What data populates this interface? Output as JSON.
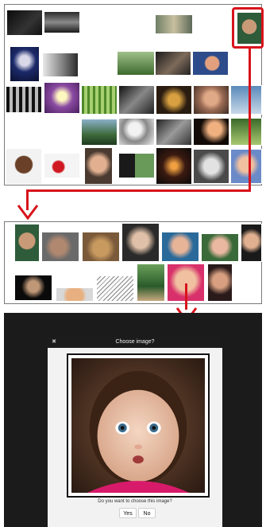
{
  "dialog": {
    "title": "Choose image?",
    "close_glyph": "✖",
    "question": "Do you want to choose this image?",
    "yes_label": "Yes",
    "no_label": "No"
  },
  "icons": {
    "close": "close-icon",
    "arrow": "arrow-down-icon",
    "thumbnail": "image-thumbnail"
  },
  "colors": {
    "highlight": "#d8131c",
    "dialog_header": "#1c1c1c",
    "backdrop": "#1b1b1b"
  }
}
